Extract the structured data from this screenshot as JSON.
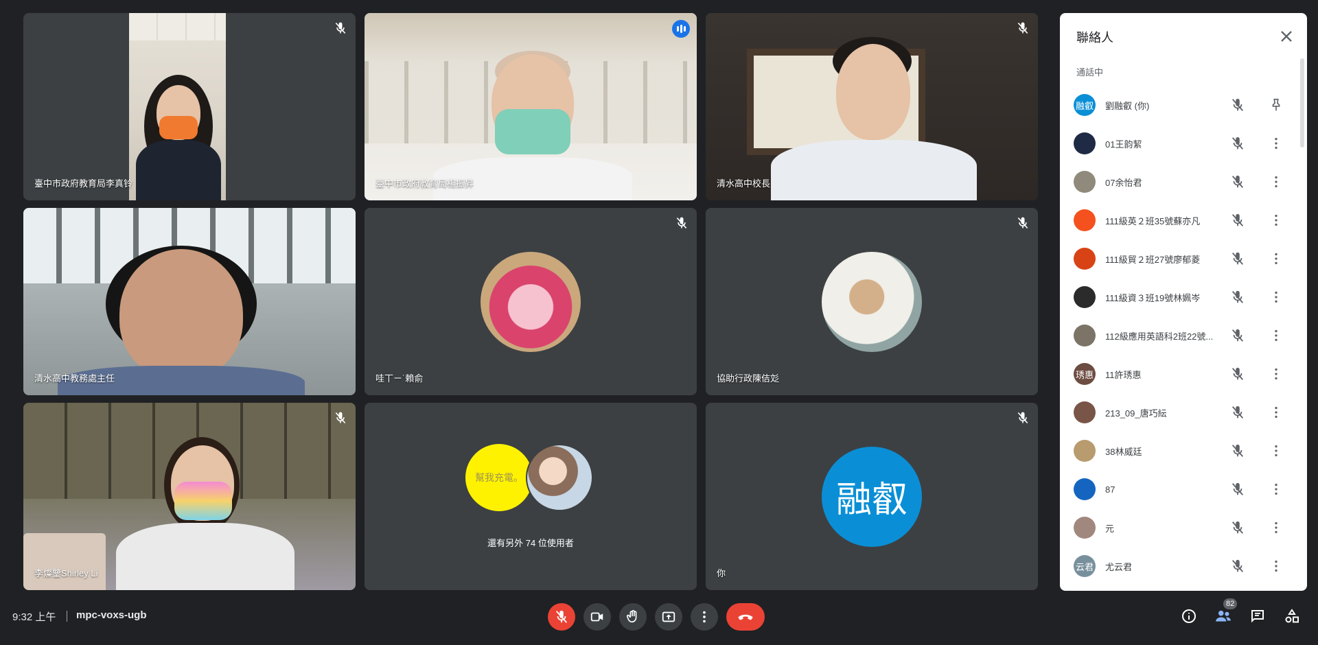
{
  "meeting": {
    "time": "9:32 上午",
    "code": "mpc-voxs-ugb"
  },
  "tiles": [
    {
      "name": "臺中市政府教育局李真铃"
    },
    {
      "name": "臺中市政府教育局楊振昇"
    },
    {
      "name": "清水高中校長"
    },
    {
      "name": "清水高中教務處主任"
    },
    {
      "name": "哇丅ㄧ˙賴俞"
    },
    {
      "name": "協助行政陳佶彣"
    },
    {
      "name": "李燦鑒Shirley Li"
    },
    {
      "name": "",
      "others_text": "還有另外 74 位使用者",
      "yellow_avatar_text": "幫我充電。"
    },
    {
      "name": "你",
      "avatar_text": "融叡"
    }
  ],
  "panel": {
    "title": "聯絡人",
    "section": "通話中",
    "participants": [
      {
        "name": "劉融叡 (你)",
        "avatar_text": "融叡",
        "avatar_color": "#0a8fd6"
      },
      {
        "name": "01王韵絜",
        "avatar_text": "",
        "avatar_color": "#1f2a44"
      },
      {
        "name": "07余怡君",
        "avatar_text": "",
        "avatar_color": "#8f8a7c"
      },
      {
        "name": "111級英２班35號蘇亦凡",
        "avatar_text": "",
        "avatar_color": "#f4511e"
      },
      {
        "name": "111級貿２班27號廖郁菱",
        "avatar_text": "",
        "avatar_color": "#d84315"
      },
      {
        "name": "111級資３班19號林姵岑",
        "avatar_text": "",
        "avatar_color": "#2b2b2b"
      },
      {
        "name": "112級應用英語科2班22號...",
        "avatar_text": "",
        "avatar_color": "#7b7467"
      },
      {
        "name": "11許琇惠",
        "avatar_text": "琇惠",
        "avatar_color": "#6d4c41"
      },
      {
        "name": "213_09_唐巧紜",
        "avatar_text": "",
        "avatar_color": "#795548"
      },
      {
        "name": "38林威廷",
        "avatar_text": "",
        "avatar_color": "#b89b6e"
      },
      {
        "name": "87",
        "avatar_text": "",
        "avatar_color": "#1565c0"
      },
      {
        "name": "元",
        "avatar_text": "",
        "avatar_color": "#a1887f"
      },
      {
        "name": "尤云君",
        "avatar_text": "云君",
        "avatar_color": "#78909c"
      }
    ]
  },
  "bottom": {
    "participant_count": "82"
  },
  "colors": {
    "accent": "#8ab4f8",
    "danger": "#ea4335",
    "bar": "#3c4043"
  }
}
